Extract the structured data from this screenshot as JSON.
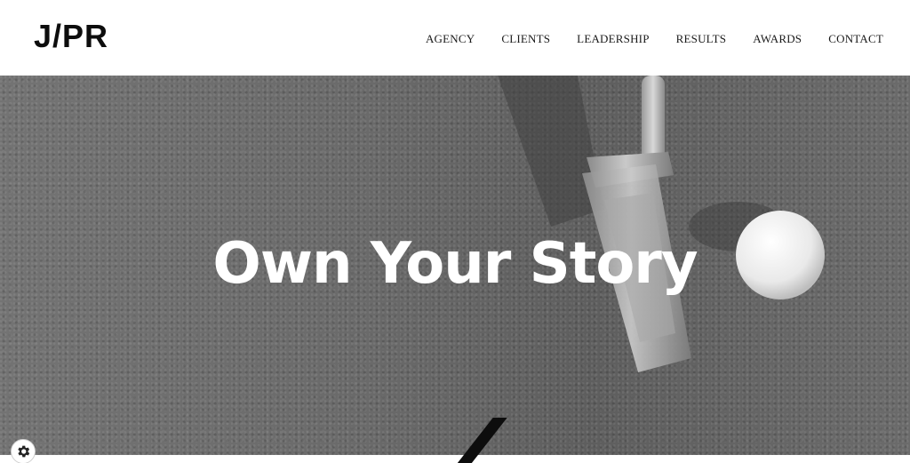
{
  "header": {
    "logo": "J/PR",
    "nav": [
      "AGENCY",
      "CLIENTS",
      "LEADERSHIP",
      "RESULTS",
      "AWARDS",
      "CONTACT"
    ]
  },
  "hero": {
    "title": "Own Your Story"
  },
  "icons": {
    "settings": "gear-icon"
  },
  "colors": {
    "header_bg": "#ffffff",
    "text_dark": "#0d0d0d",
    "hero_title": "#ffffff"
  }
}
